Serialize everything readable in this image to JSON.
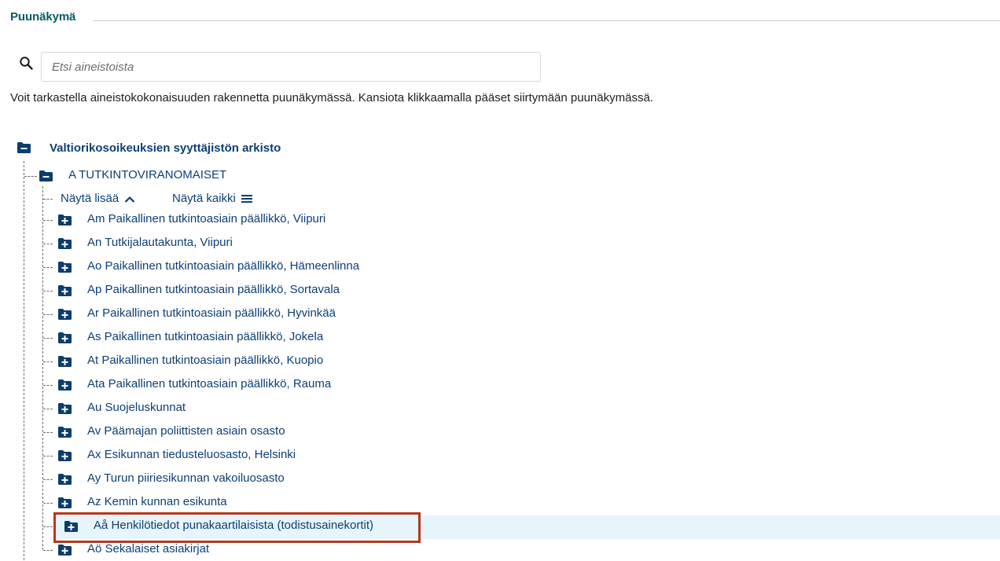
{
  "section": {
    "title": "Puunäkymä"
  },
  "search": {
    "placeholder": "Etsi aineistoista",
    "value": ""
  },
  "description": "Voit tarkastella aineistokokonaisuuden rakennetta puunäkymässä. Kansiota klikkaamalla pääset siirtymään puunäkymässä.",
  "tree": {
    "root": {
      "label": "Valtiorikosoikeuksien syyttäjistön arkisto",
      "state": "expanded"
    },
    "child": {
      "label": "A TUTKINTOVIRANOMAISET",
      "state": "expanded"
    },
    "controls": {
      "show_more": "Näytä lisää",
      "show_all": "Näytä kaikki"
    },
    "items": [
      {
        "label": "Am Paikallinen tutkintoasiain päällikkö, Viipuri"
      },
      {
        "label": "An Tutkijalautakunta, Viipuri"
      },
      {
        "label": "Ao Paikallinen tutkintoasiain päällikkö, Hämeenlinna"
      },
      {
        "label": "Ap Paikallinen tutkintoasiain päällikkö, Sortavala"
      },
      {
        "label": "Ar Paikallinen tutkintoasiain päällikkö, Hyvinkää"
      },
      {
        "label": "As Paikallinen tutkintoasiain päällikkö, Jokela"
      },
      {
        "label": "At Paikallinen tutkintoasiain päällikkö, Kuopio"
      },
      {
        "label": "Ata Paikallinen tutkintoasiain päällikkö, Rauma"
      },
      {
        "label": "Au Suojeluskunnat"
      },
      {
        "label": "Av Päämajan poliittisten asiain osasto"
      },
      {
        "label": "Ax Esikunnan tiedusteluosasto, Helsinki"
      },
      {
        "label": "Ay Turun piiriesikunnan vakoiluosasto"
      },
      {
        "label": "Az Kemin kunnan esikunta"
      },
      {
        "label": "Aå Henkilötiedot punakaartilaisista (todistusainekortit)",
        "selected": true
      },
      {
        "label": "Aö Sekalaiset asiakirjat"
      }
    ]
  },
  "colors": {
    "accent": "#0a5b63",
    "link": "#0d3f75",
    "folder": "#0b3d6d",
    "selected_bg": "#e6f4fb",
    "highlight_border": "#b3391a"
  },
  "icons": {
    "search": "search-icon",
    "collapse": "folder-minus-icon",
    "expand": "folder-plus-icon",
    "chevron": "chevron-up-icon",
    "list": "list-icon"
  }
}
